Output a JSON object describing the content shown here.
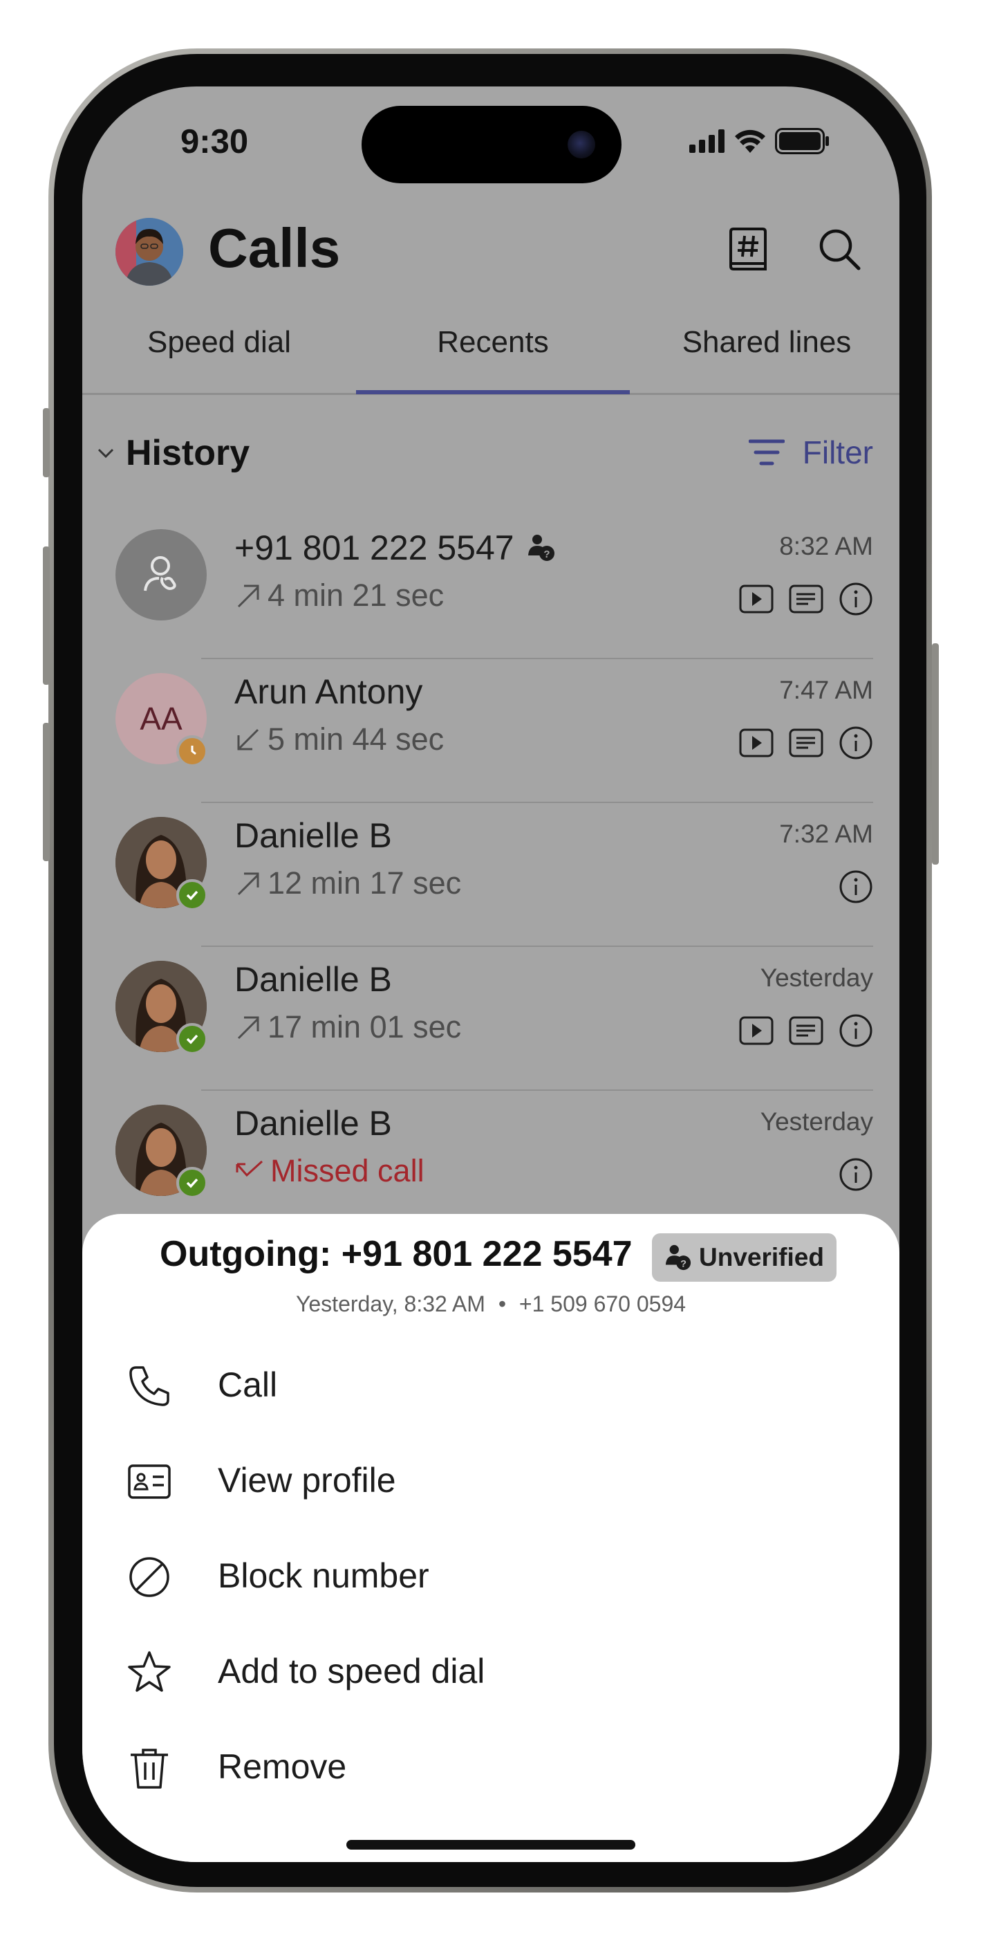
{
  "status": {
    "time": "9:30"
  },
  "header": {
    "title": "Calls",
    "dialpad_icon": "dialpad-hash-icon",
    "search_icon": "search-icon"
  },
  "tabs": [
    {
      "label": "Speed dial",
      "active": false
    },
    {
      "label": "Recents",
      "active": true
    },
    {
      "label": "Shared lines",
      "active": false
    }
  ],
  "history": {
    "title": "History",
    "filter_label": "Filter",
    "rows": [
      {
        "name": "+91 801 222 5547",
        "detail": "4 min 21 sec",
        "direction": "outgoing",
        "time": "8:32 AM",
        "avatar": "phone-person-icon",
        "unverified": true,
        "actions": [
          "play-icon",
          "transcript-icon",
          "info-icon"
        ]
      },
      {
        "name": "Arun Antony",
        "initials": "AA",
        "detail": "5 min 44 sec",
        "direction": "incoming",
        "time": "7:47 AM",
        "presence": "away",
        "actions": [
          "play-icon",
          "transcript-icon",
          "info-icon"
        ]
      },
      {
        "name": "Danielle B",
        "detail": "12 min 17 sec",
        "direction": "outgoing",
        "time": "7:32 AM",
        "presence": "available",
        "actions": [
          "info-icon"
        ]
      },
      {
        "name": "Danielle B",
        "detail": "17 min 01 sec",
        "direction": "outgoing",
        "time": "Yesterday",
        "presence": "available",
        "actions": [
          "play-icon",
          "transcript-icon",
          "info-icon"
        ]
      },
      {
        "name": "Danielle B",
        "detail": "Missed call",
        "direction": "missed",
        "time": "Yesterday",
        "presence": "available",
        "actions": [
          "info-icon"
        ]
      }
    ]
  },
  "sheet": {
    "title": "Outgoing: +91 801 222 5547",
    "badge": "Unverified",
    "subtitle_time": "Yesterday, 8:32 AM",
    "subtitle_number": "+1 509 670 0594",
    "items": [
      {
        "label": "Call",
        "icon": "phone-icon"
      },
      {
        "label": "View profile",
        "icon": "contact-card-icon"
      },
      {
        "label": "Block number",
        "icon": "block-icon"
      },
      {
        "label": "Add to speed dial",
        "icon": "star-icon"
      },
      {
        "label": "Remove",
        "icon": "trash-icon"
      }
    ]
  },
  "colors": {
    "accent": "#464a8c",
    "missed": "#a4262c",
    "available": "#6bb700",
    "away": "#f8a73b"
  }
}
